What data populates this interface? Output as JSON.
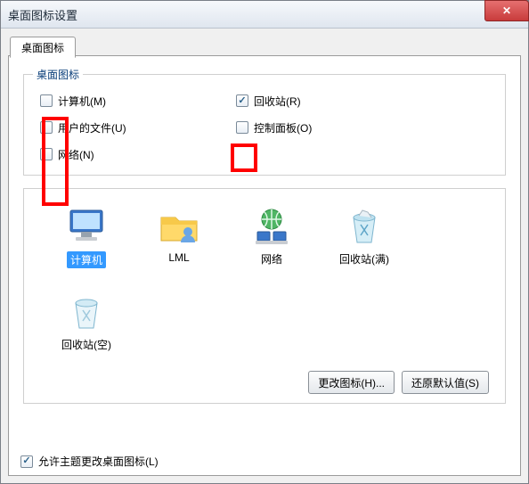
{
  "window": {
    "title": "桌面图标设置",
    "close_glyph": "✕"
  },
  "tab": {
    "label": "桌面图标"
  },
  "group1": {
    "legend": "桌面图标",
    "checks": {
      "computer": {
        "label": "计算机(M)",
        "checked": false
      },
      "recycle": {
        "label": "回收站(R)",
        "checked": true
      },
      "userfiles": {
        "label": "用户的文件(U)",
        "checked": false
      },
      "control": {
        "label": "控制面板(O)",
        "checked": false
      },
      "network": {
        "label": "网络(N)",
        "checked": false
      }
    }
  },
  "icons": [
    {
      "key": "computer",
      "label": "计算机",
      "selected": true
    },
    {
      "key": "lml",
      "label": "LML",
      "selected": false
    },
    {
      "key": "network",
      "label": "网络",
      "selected": false
    },
    {
      "key": "recycle_full",
      "label": "回收站(满)",
      "selected": false
    },
    {
      "key": "recycle_empty",
      "label": "回收站(空)",
      "selected": false
    }
  ],
  "buttons": {
    "change_icon": "更改图标(H)...",
    "restore_default": "还原默认值(S)"
  },
  "theme_check": {
    "label": "允许主题更改桌面图标(L)",
    "checked": true
  }
}
